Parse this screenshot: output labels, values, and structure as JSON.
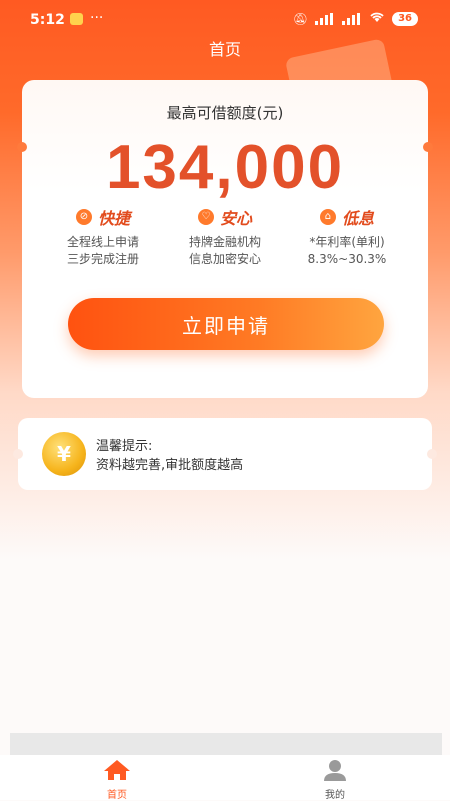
{
  "status_bar": {
    "time": "5:12",
    "dots": "···",
    "battery": "36"
  },
  "nav": {
    "title": "首页"
  },
  "loan_card": {
    "label": "最高可借额度(元)",
    "amount": "134,000",
    "features": [
      {
        "icon": "compass-icon",
        "glyph": "⊘",
        "title": "快捷",
        "line1": "全程线上申请",
        "line2": "三步完成注册"
      },
      {
        "icon": "shield-icon",
        "glyph": "♡",
        "title": "安心",
        "line1": "持牌金融机构",
        "line2": "信息加密安心"
      },
      {
        "icon": "wallet-icon",
        "glyph": "⌂",
        "title": "低息",
        "line1": "*年利率(单利)",
        "line2": "8.3%~30.3%"
      }
    ],
    "apply_button": "立即申请"
  },
  "tip_card": {
    "coin_symbol": "¥",
    "title": "温馨提示:",
    "text": "资料越完善,审批额度越高"
  },
  "tab_bar": {
    "tabs": [
      {
        "label": "首页",
        "icon": "home-icon",
        "active": true
      },
      {
        "label": "我的",
        "icon": "user-icon",
        "active": false
      }
    ]
  },
  "colors": {
    "brand": "#ff5a22",
    "amount": "#e3512a",
    "coin": "#f6b41c"
  }
}
